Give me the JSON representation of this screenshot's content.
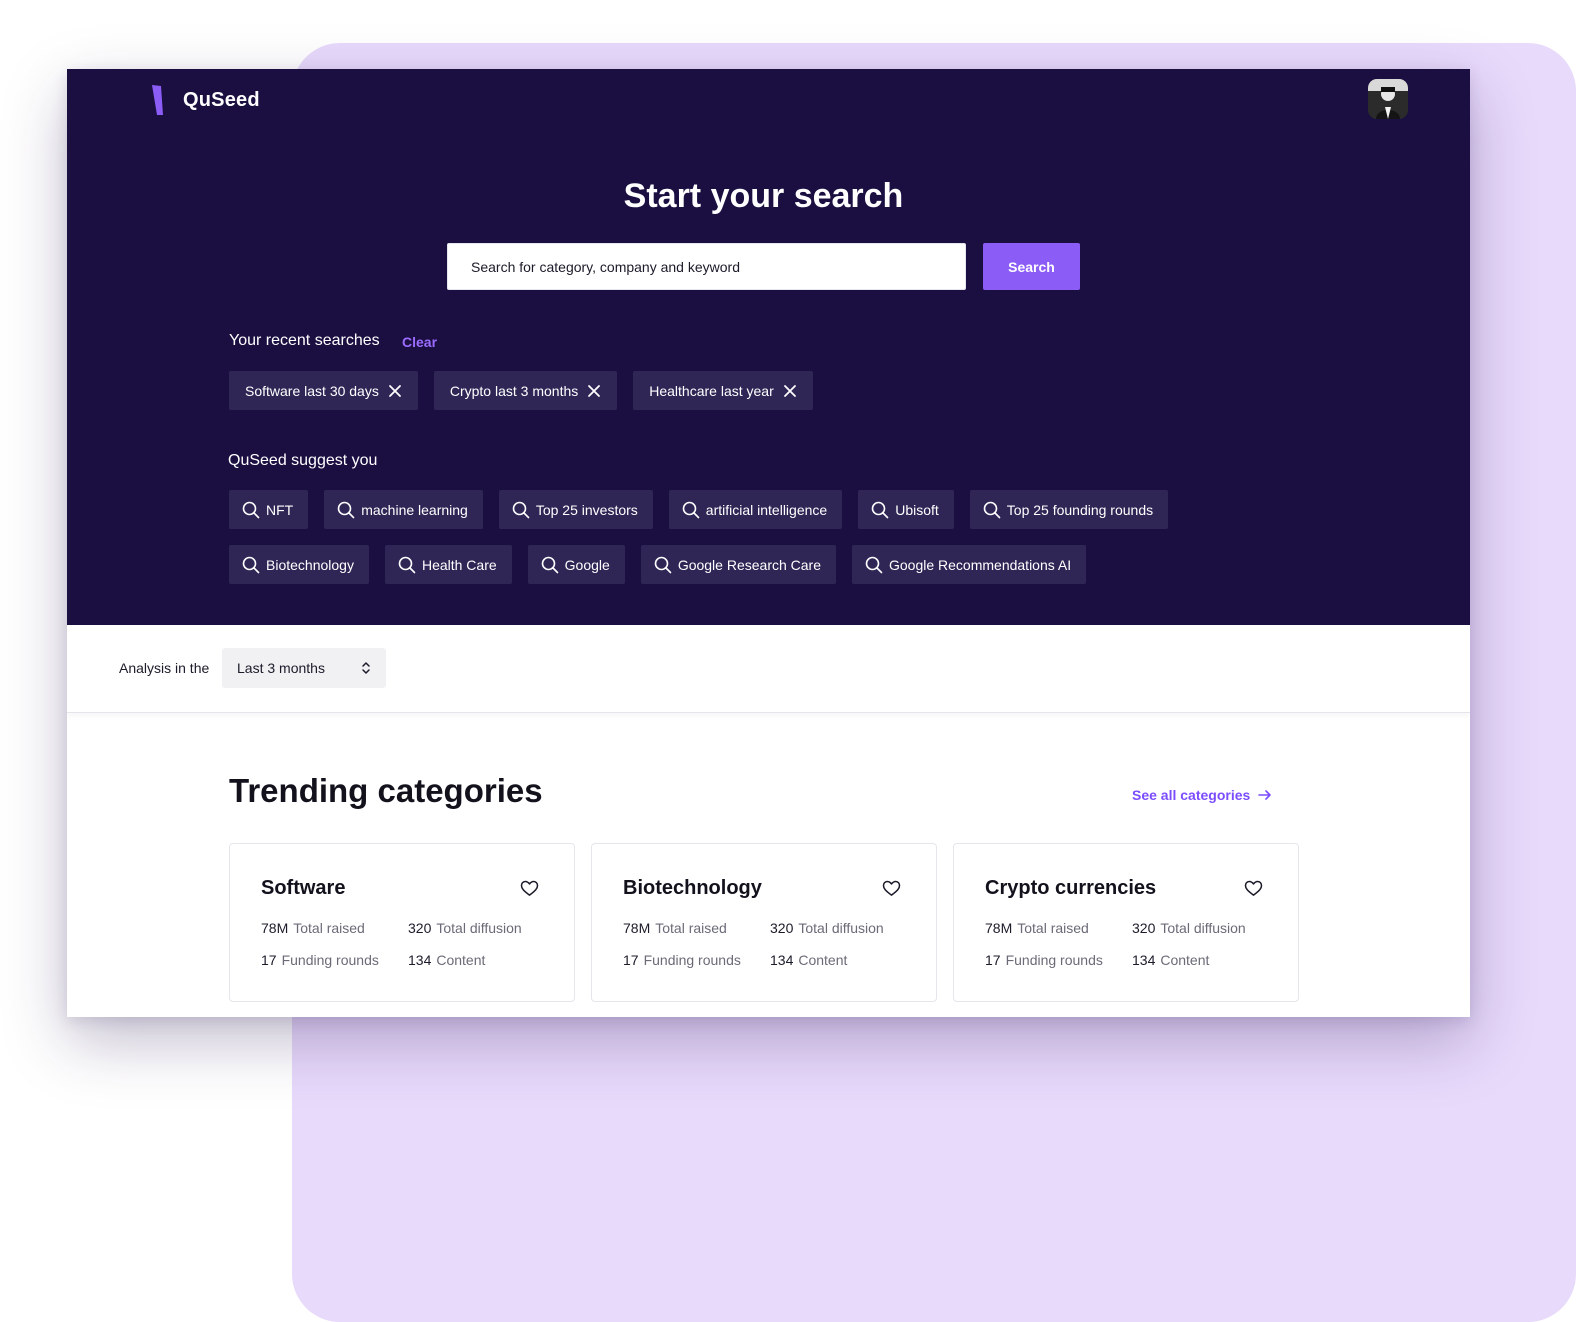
{
  "app": {
    "name": "QuSeed",
    "accent_color": "#8b5cf6",
    "hero_background": "#1b0f42",
    "backdrop_color": "#e8dafb"
  },
  "header": {
    "avatar_icon": "user-avatar"
  },
  "hero": {
    "title": "Start your search"
  },
  "search": {
    "placeholder": "Search for category, company and keyword",
    "button_label": "Search"
  },
  "recent": {
    "title": "Your recent searches",
    "clear_label": "Clear",
    "items": [
      {
        "label": "Software last 30 days"
      },
      {
        "label": "Crypto last 3 months"
      },
      {
        "label": "Healthcare last year"
      }
    ]
  },
  "suggest": {
    "title": "QuSeed suggest you",
    "rows": [
      [
        {
          "label": "NFT"
        },
        {
          "label": "machine learning"
        },
        {
          "label": "Top 25 investors"
        },
        {
          "label": "artificial intelligence"
        },
        {
          "label": "Ubisoft"
        },
        {
          "label": "Top 25 founding rounds"
        }
      ],
      [
        {
          "label": "Biotechnology"
        },
        {
          "label": "Health Care"
        },
        {
          "label": "Google"
        },
        {
          "label": "Google Research Care"
        },
        {
          "label": "Google Recommendations AI"
        }
      ]
    ]
  },
  "analysis": {
    "label": "Analysis in the",
    "period": "Last 3 months"
  },
  "trending": {
    "title": "Trending categories",
    "see_all_label": "See all categories",
    "cards": [
      {
        "title": "Software",
        "total_raised_value": "78M",
        "total_raised_label": "Total raised",
        "total_diffusion_value": "320",
        "total_diffusion_label": "Total diffusion",
        "funding_rounds_value": "17",
        "funding_rounds_label": "Funding rounds",
        "content_value": "134",
        "content_label": "Content"
      },
      {
        "title": "Biotechnology",
        "total_raised_value": "78M",
        "total_raised_label": "Total raised",
        "total_diffusion_value": "320",
        "total_diffusion_label": "Total diffusion",
        "funding_rounds_value": "17",
        "funding_rounds_label": "Funding rounds",
        "content_value": "134",
        "content_label": "Content"
      },
      {
        "title": "Crypto currencies",
        "total_raised_value": "78M",
        "total_raised_label": "Total raised",
        "total_diffusion_value": "320",
        "total_diffusion_label": "Total diffusion",
        "funding_rounds_value": "17",
        "funding_rounds_label": "Funding rounds",
        "content_value": "134",
        "content_label": "Content"
      }
    ]
  }
}
